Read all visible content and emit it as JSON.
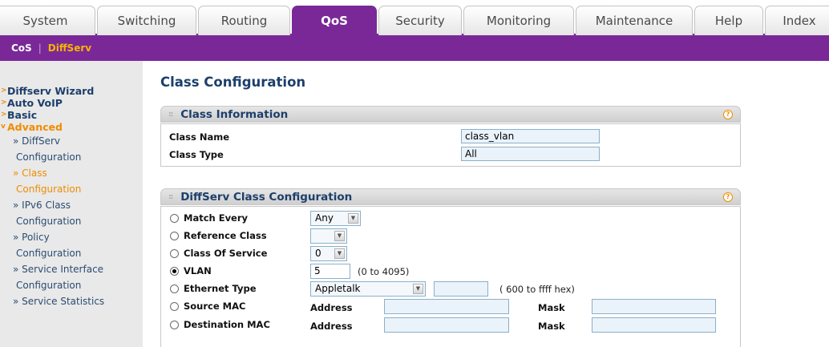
{
  "tabs": [
    {
      "label": "System"
    },
    {
      "label": "Switching"
    },
    {
      "label": "Routing"
    },
    {
      "label": "QoS"
    },
    {
      "label": "Security"
    },
    {
      "label": "Monitoring"
    },
    {
      "label": "Maintenance"
    },
    {
      "label": "Help"
    },
    {
      "label": "Index"
    }
  ],
  "subnav": {
    "items": [
      {
        "label": "CoS"
      },
      {
        "label": "DiffServ"
      }
    ],
    "separator": "|"
  },
  "sidebar": {
    "items": [
      {
        "label": "Diffserv Wizard"
      },
      {
        "label": "Auto VoIP"
      },
      {
        "label": "Basic"
      },
      {
        "label": "Advanced"
      }
    ],
    "subitems": [
      {
        "line1": "» DiffServ",
        "line2": "Configuration"
      },
      {
        "line1": "» Class",
        "line2": "Configuration"
      },
      {
        "line1": "» IPv6 Class",
        "line2": "Configuration"
      },
      {
        "line1": "» Policy",
        "line2": "Configuration"
      },
      {
        "line1": "» Service Interface",
        "line2": "Configuration"
      },
      {
        "line1": "» Service Statistics",
        "line2": ""
      }
    ]
  },
  "main": {
    "page_title": "Class Configuration",
    "class_info": {
      "title": "Class Information",
      "class_name_label": "Class Name",
      "class_name_value": "class_vlan",
      "class_type_label": "Class Type",
      "class_type_value": "All"
    },
    "diffserv": {
      "title": "DiffServ Class Configuration",
      "match_every": {
        "label": "Match Every",
        "value": "Any"
      },
      "reference_class": {
        "label": "Reference Class",
        "value": ""
      },
      "class_of_service": {
        "label": "Class Of Service",
        "value": "0"
      },
      "vlan": {
        "label": "VLAN",
        "value": "5",
        "hint": "(0 to 4095)",
        "selected": true
      },
      "ethernet_type": {
        "label": "Ethernet Type",
        "value": "Appletalk",
        "extra": "",
        "hint": "( 600 to ffff hex)"
      },
      "source_mac": {
        "label": "Source MAC",
        "address_label": "Address",
        "mask_label": "Mask",
        "address": "",
        "mask": ""
      },
      "destination_mac": {
        "label": "Destination MAC",
        "address_label": "Address",
        "mask_label": "Mask",
        "address": "",
        "mask": ""
      }
    }
  },
  "icons": {
    "help": "?",
    "dropdown": "▼",
    "arrow": ">",
    "arrow_open": "v",
    "dots": "::"
  },
  "colors": {
    "accent": "#7a2898",
    "highlight": "#f08c00",
    "link": "#1d3f6b"
  }
}
